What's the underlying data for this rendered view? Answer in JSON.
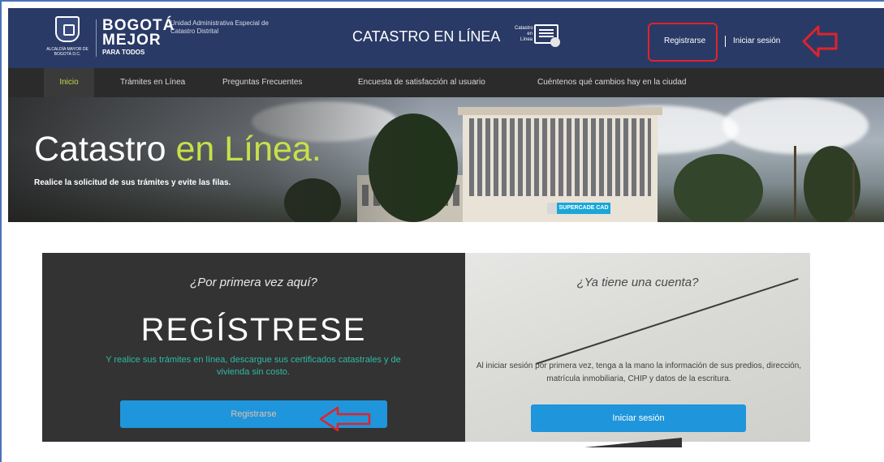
{
  "header": {
    "escudo_caption": "Alcaldía Mayor de Bogotá D.C.",
    "brand_line1": "BOGOTÁ",
    "brand_line2": "MEJOR",
    "brand_line3": "PARA TODOS",
    "entity": "Unidad Administrativa Especial de Catastro Distrital",
    "site_title": "CATASTRO EN LÍNEA",
    "logo_text": "Catastro en Línea",
    "register_link": "Registrarse",
    "login_link": "Iniciar sesión",
    "header_color": "#2a3a66",
    "highlight_color": "#e0232a"
  },
  "nav": {
    "items": [
      "Inicio",
      "Trámites en Línea",
      "Preguntas Frecuentes",
      "Encuesta de satisfacción al usuario",
      "Cuéntenos qué cambios hay en la ciudad"
    ],
    "active_index": 0,
    "accent_color": "#c2d84a"
  },
  "hero": {
    "title_main": "Catastro ",
    "title_accent": "en Línea",
    "title_dot": ".",
    "subtitle": "Realice la solicitud de sus trámites y evite las filas.",
    "sign_text": "SUPERCADE CAD"
  },
  "register_panel": {
    "question": "¿Por primera vez aquí?",
    "heading": "REGÍSTRESE",
    "description": "Y realice sus trámites en línea, descargue sus certificados catastrales y de vivienda sin costo.",
    "button": "Registrarse"
  },
  "login_panel": {
    "question": "¿Ya tiene una cuenta?",
    "description": "Al iniciar sesión por primera vez, tenga a la mano la información de sus predios, dirección, matrícula inmobiliaria, CHIP y datos de la escritura.",
    "button": "Iniciar sesión"
  },
  "annotations": {
    "arrow_color": "#e0232a"
  }
}
